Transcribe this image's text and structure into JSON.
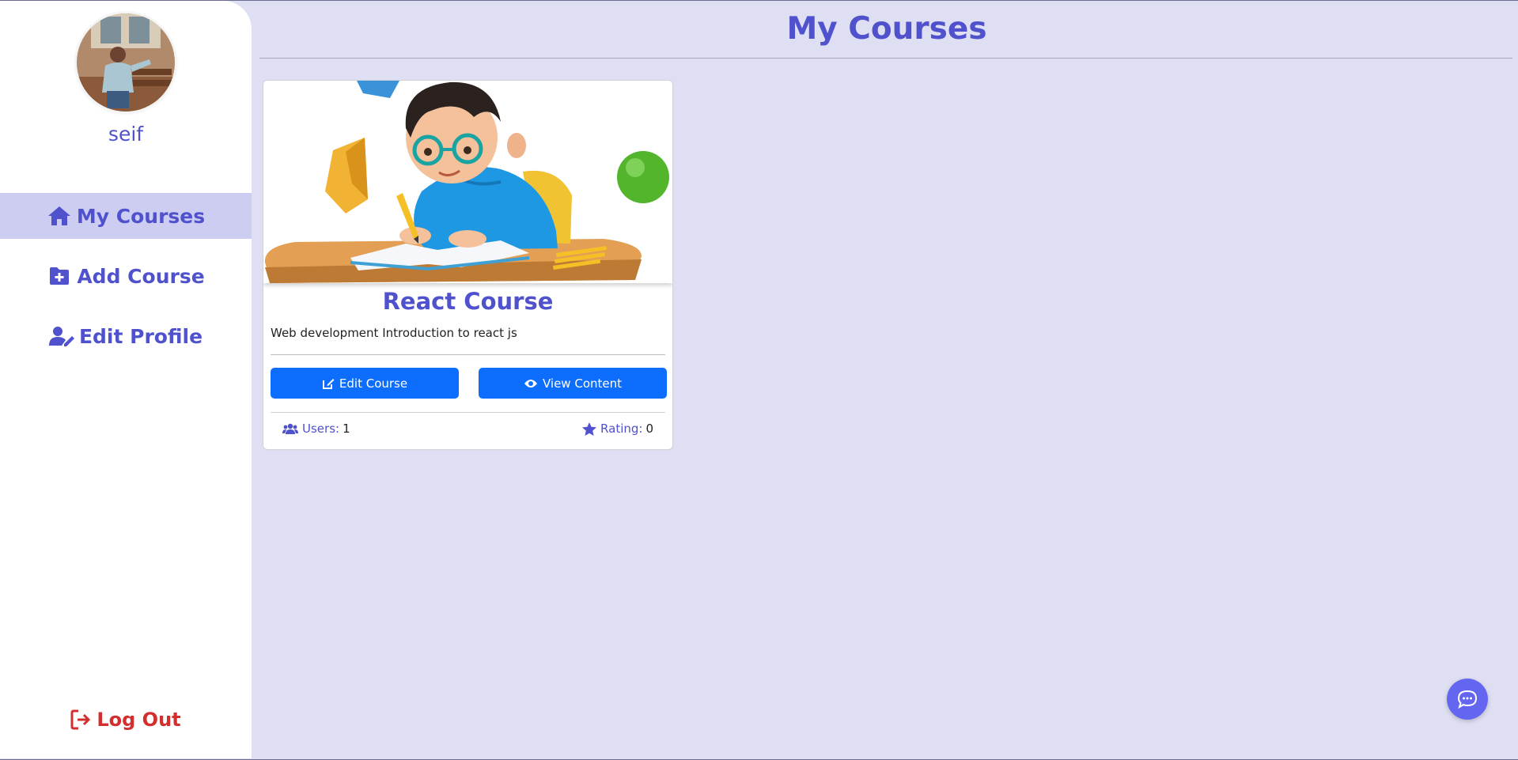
{
  "user": {
    "name": "seif"
  },
  "nav": {
    "items": [
      {
        "label": "My Courses",
        "icon": "home-icon",
        "active": true
      },
      {
        "label": "Add Course",
        "icon": "folder-plus-icon",
        "active": false
      },
      {
        "label": "Edit Profile",
        "icon": "user-edit-icon",
        "active": false
      }
    ],
    "logout_label": "Log Out"
  },
  "page": {
    "title": "My Courses"
  },
  "courses": [
    {
      "title": "React Course",
      "description": "Web development Introduction to react js",
      "edit_label": "Edit Course",
      "view_label": "View Content",
      "users_label": "Users:",
      "users_value": "1",
      "rating_label": "Rating:",
      "rating_value": "0"
    }
  ],
  "colors": {
    "accent": "#4f52cc",
    "primary_button": "#0d6efd",
    "logout": "#d32f2f",
    "background": "#dfdff3",
    "active_nav": "#cdcdf2",
    "chat_button": "#6366f1"
  }
}
